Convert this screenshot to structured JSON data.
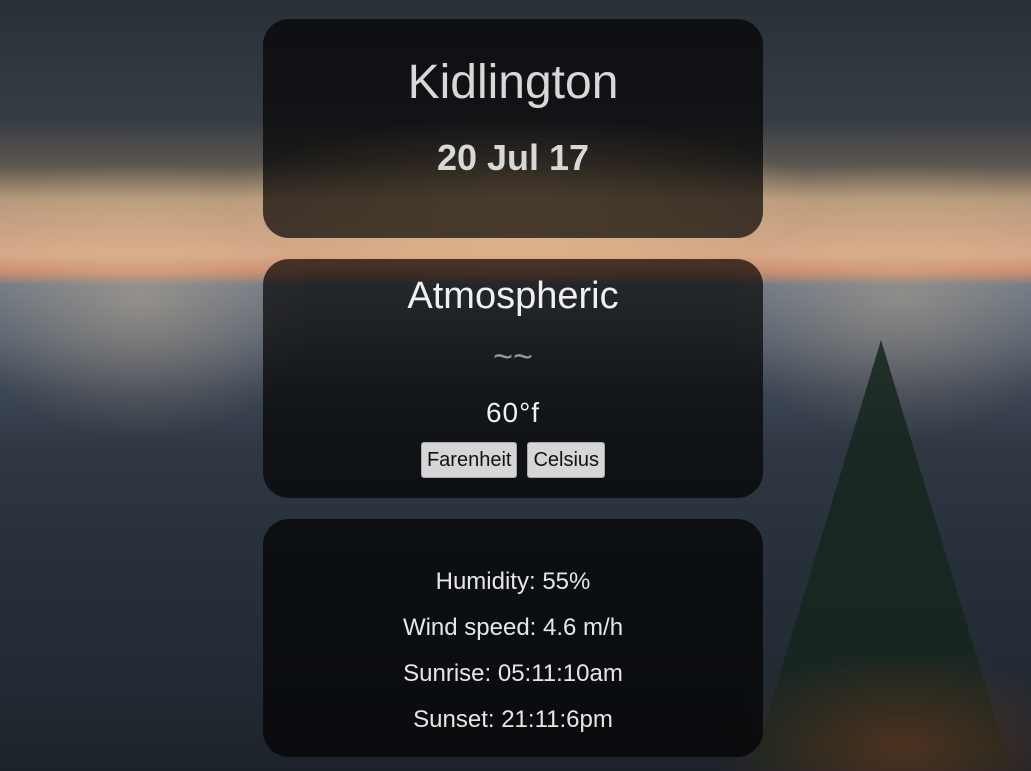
{
  "location": {
    "city": "Kidlington",
    "date": "20 Jul 17"
  },
  "weather": {
    "condition": "Atmospheric",
    "icon": "mist-icon",
    "icon_glyph": "~~",
    "temperature": "60°f",
    "unit_buttons": {
      "fahrenheit": "Farenheit",
      "celsius": "Celsius"
    }
  },
  "details": {
    "humidity": "Humidity: 55%",
    "wind_speed": "Wind speed: 4.6 m/h",
    "sunrise": "Sunrise: 05:11:10am",
    "sunset": "Sunset: 21:11:6pm"
  },
  "colors": {
    "card_bg": "#000000",
    "button_bg": "#d6d6d6",
    "text": "#e8e8e8"
  }
}
